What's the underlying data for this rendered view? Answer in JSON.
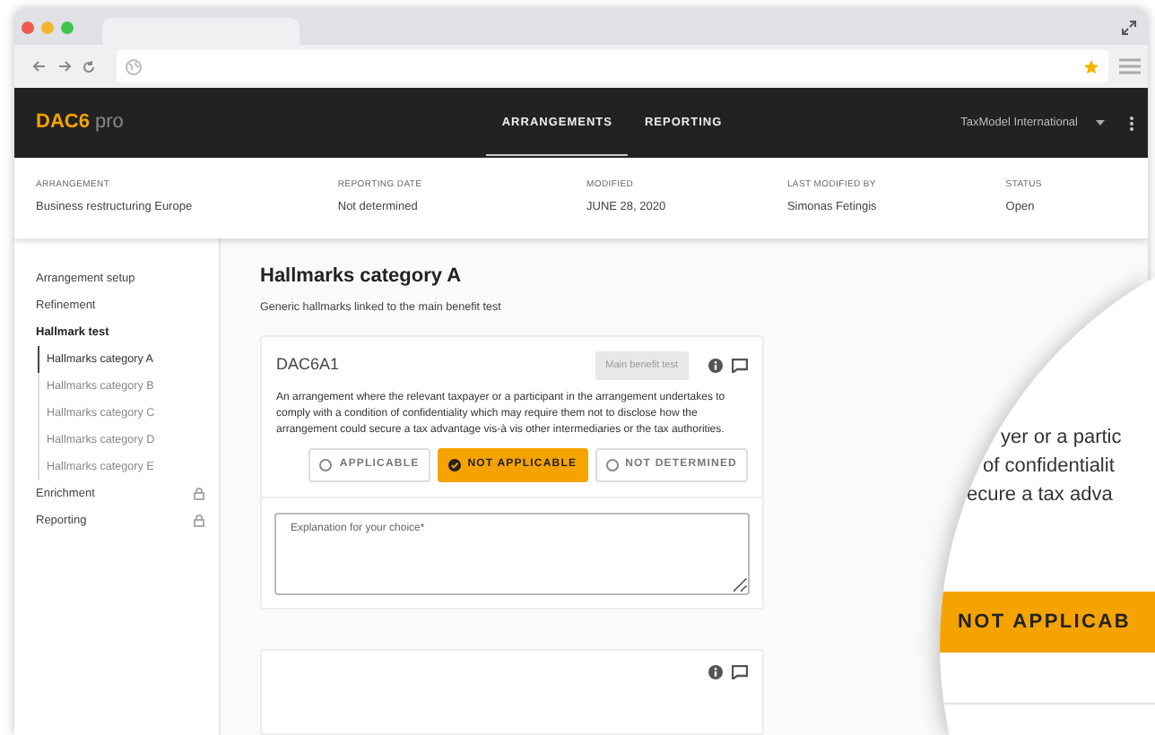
{
  "app": {
    "logo": "DAC6",
    "logo_suffix": "pro",
    "account": "TaxModel International",
    "nav": [
      {
        "label": "ARRANGEMENTS",
        "selected": true
      },
      {
        "label": "REPORTING",
        "selected": false
      }
    ]
  },
  "summary": [
    {
      "label": "ARRANGEMENT",
      "value": "Business restructuring Europe"
    },
    {
      "label": "REPORTING DATE",
      "value": "Not determined"
    },
    {
      "label": "MODIFIED",
      "value": "JUNE 28, 2020"
    },
    {
      "label": "LAST MODIFIED BY",
      "value": "Simonas Fetingis"
    },
    {
      "label": "STATUS",
      "value": "Open"
    }
  ],
  "sidebar": [
    {
      "label": "Arrangement setup",
      "locked": false,
      "expanded": false
    },
    {
      "label": "Refinement",
      "locked": false,
      "expanded": false
    },
    {
      "label": "Hallmark test",
      "locked": false,
      "expanded": true,
      "children": [
        {
          "label": "Hallmarks category A",
          "selected": true
        },
        {
          "label": "Hallmarks category B",
          "selected": false
        },
        {
          "label": "Hallmarks category C",
          "selected": false
        },
        {
          "label": "Hallmarks category D",
          "selected": false
        },
        {
          "label": "Hallmarks category E",
          "selected": false
        }
      ]
    },
    {
      "label": "Enrichment",
      "locked": true,
      "expanded": false
    },
    {
      "label": "Reporting",
      "locked": true,
      "expanded": false
    }
  ],
  "page": {
    "title": "Hallmarks category A",
    "subtitle": "Generic hallmarks linked to the main benefit test"
  },
  "cards": [
    {
      "kind": "full",
      "code": "DAC6A1",
      "tag": "Main benefit test",
      "description": "An arrangement where the relevant taxpayer or a participant in the arrangement undertakes to comply with a condition of confidentiality which may require them not to disclose how the arrangement could secure a tax advantage vis-à vis other intermediaries or the tax authorities.",
      "options": [
        {
          "label": "APPLICABLE",
          "selected": false
        },
        {
          "label": "NOT APPLICABLE",
          "selected": true
        },
        {
          "label": "NOT DETERMINED",
          "selected": false
        }
      ],
      "explanation": {
        "placeholder": "Explanation for your choice*"
      }
    },
    {
      "kind": "partial"
    }
  ],
  "magnifier": {
    "lines": [
      "yer or a partic",
      "of confidentialit",
      "ecure a tax adva"
    ],
    "option": {
      "label": "NOT APPLICAB",
      "selected": true
    }
  }
}
